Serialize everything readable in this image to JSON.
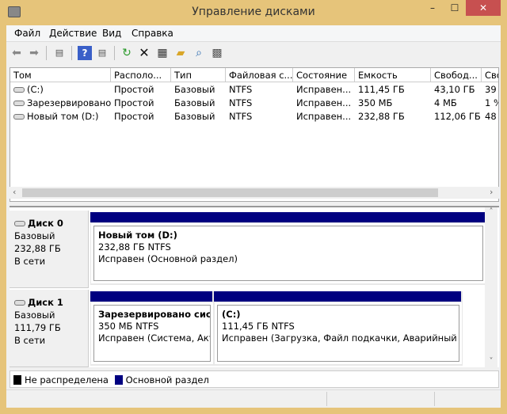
{
  "window": {
    "title": "Управление дисками",
    "minimize": "–",
    "maximize": "☐",
    "close": "✕"
  },
  "menu": [
    "Файл",
    "Действие",
    "Вид",
    "Справка"
  ],
  "toolbar": [
    "back-icon",
    "forward-icon",
    "console-tree-icon",
    "help-icon",
    "action-pane-icon",
    "refresh-icon",
    "delete-icon",
    "properties-icon",
    "open-icon",
    "search-icon",
    "settings-icon"
  ],
  "columns": [
    "Том",
    "Располо...",
    "Тип",
    "Файловая с...",
    "Состояние",
    "Емкость",
    "Свобод...",
    "Сво"
  ],
  "rows": [
    [
      "(C:)",
      "Простой",
      "Базовый",
      "NTFS",
      "Исправен...",
      "111,45 ГБ",
      "43,10 ГБ",
      "39"
    ],
    [
      "Зарезервировано...",
      "Простой",
      "Базовый",
      "NTFS",
      "Исправен...",
      "350 МБ",
      "4 МБ",
      "1 %"
    ],
    [
      "Новый том (D:)",
      "Простой",
      "Базовый",
      "NTFS",
      "Исправен...",
      "232,88 ГБ",
      "112,06 ГБ",
      "48"
    ]
  ],
  "disks": [
    {
      "name": "Диск 0",
      "type": "Базовый",
      "size": "232,88 ГБ",
      "status": "В сети",
      "partitions": [
        {
          "name": "Новый том  (D:)",
          "size": "232,88 ГБ NTFS",
          "state": "Исправен (Основной раздел)"
        }
      ]
    },
    {
      "name": "Диск 1",
      "type": "Базовый",
      "size": "111,79 ГБ",
      "status": "В сети",
      "partitions": [
        {
          "name": "Зарезервировано систем",
          "size": "350 МБ NTFS",
          "state": "Исправен (Система, Активный)"
        },
        {
          "name": " (C:)",
          "size": "111,45 ГБ NTFS",
          "state": "Исправен (Загрузка, Файл подкачки, Аварийный дамп"
        }
      ]
    }
  ],
  "legend": [
    {
      "label": "Не распределена",
      "color": "#000000"
    },
    {
      "label": "Основной раздел",
      "color": "#000080"
    }
  ],
  "colors": {
    "frame": "#e6c47a",
    "primary_partition": "#000080",
    "close": "#c75050"
  }
}
